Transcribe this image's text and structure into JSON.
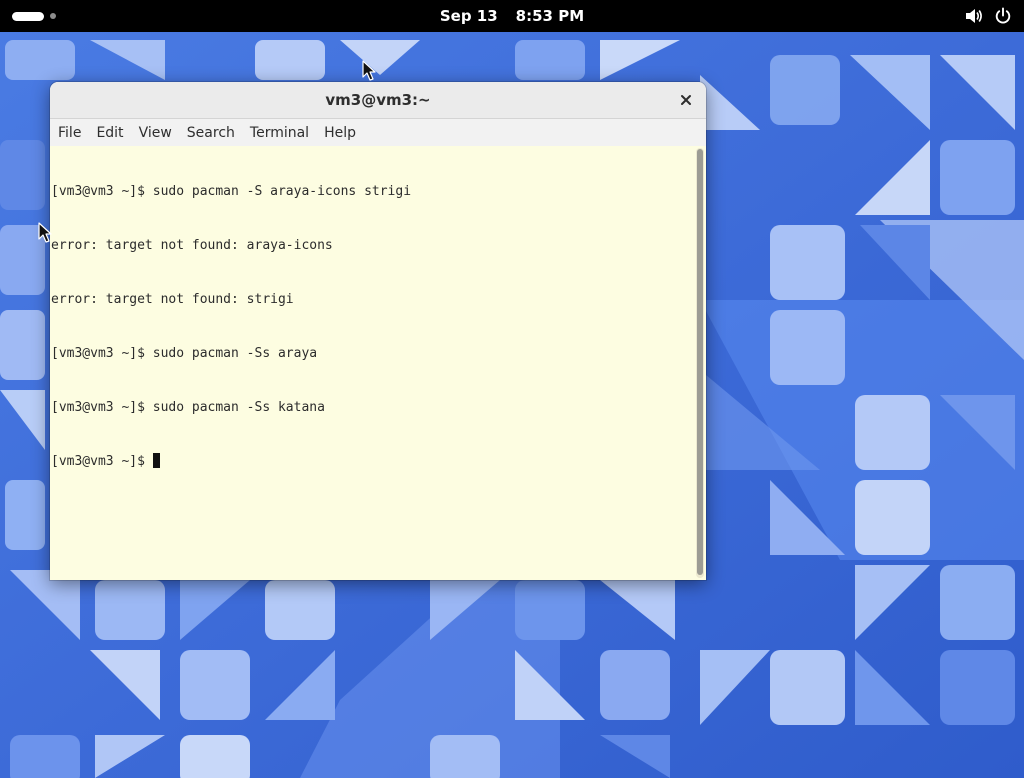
{
  "topbar": {
    "activities_icon": "activities-pill-icon",
    "date": "Sep 13",
    "time": "8:53 PM",
    "volume_icon": "volume-icon",
    "power_icon": "power-icon"
  },
  "window": {
    "title": "vm3@vm3:~",
    "close_icon": "close-icon",
    "menu": [
      "File",
      "Edit",
      "View",
      "Search",
      "Terminal",
      "Help"
    ]
  },
  "terminal": {
    "lines": [
      "[vm3@vm3 ~]$ sudo pacman -S araya-icons strigi",
      "error: target not found: araya-icons",
      "error: target not found: strigi",
      "[vm3@vm3 ~]$ sudo pacman -Ss araya",
      "[vm3@vm3 ~]$ sudo pacman -Ss katana",
      "[vm3@vm3 ~]$ "
    ],
    "background": "#fdfde1",
    "foreground": "#2c2c2c"
  },
  "colors": {
    "wallpaper_base": "#3f6fd9",
    "topbar": "#000000"
  }
}
